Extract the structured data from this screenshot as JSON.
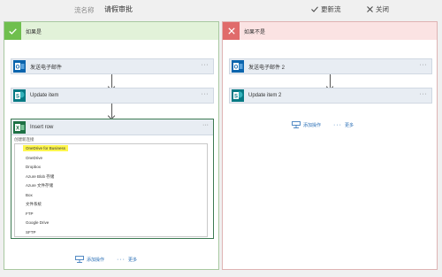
{
  "topbar": {
    "flow_label": "流名称",
    "flow_name": "请假审批",
    "update_label": "更新流",
    "close_label": "关闭"
  },
  "yes_branch": {
    "title": "如果是",
    "actions": [
      {
        "title": "发送电子邮件",
        "more": "···"
      },
      {
        "title": "Update item",
        "more": "···"
      }
    ],
    "excel": {
      "title": "Insert row",
      "more": "···",
      "conn_label": "创建新连接",
      "options": [
        "OneDrive for Business",
        "OneDrive",
        "Dropbox",
        "Azure Blob 存储",
        "Azure 文件存储",
        "Box",
        "文件系统",
        "FTP",
        "Google Drive",
        "SFTP"
      ]
    },
    "add_action": "添加操作",
    "more_label": "更多"
  },
  "no_branch": {
    "title": "如果不是",
    "actions": [
      {
        "title": "发送电子邮件 2",
        "more": "···"
      },
      {
        "title": "Update item 2",
        "more": "···"
      }
    ],
    "add_action": "添加操作",
    "more_label": "更多"
  },
  "colors": {
    "accent_link": "#2a6fb6",
    "yes_header": "#e2f2d9",
    "no_header": "#fbe3e3",
    "highlight": "#fff64d"
  }
}
